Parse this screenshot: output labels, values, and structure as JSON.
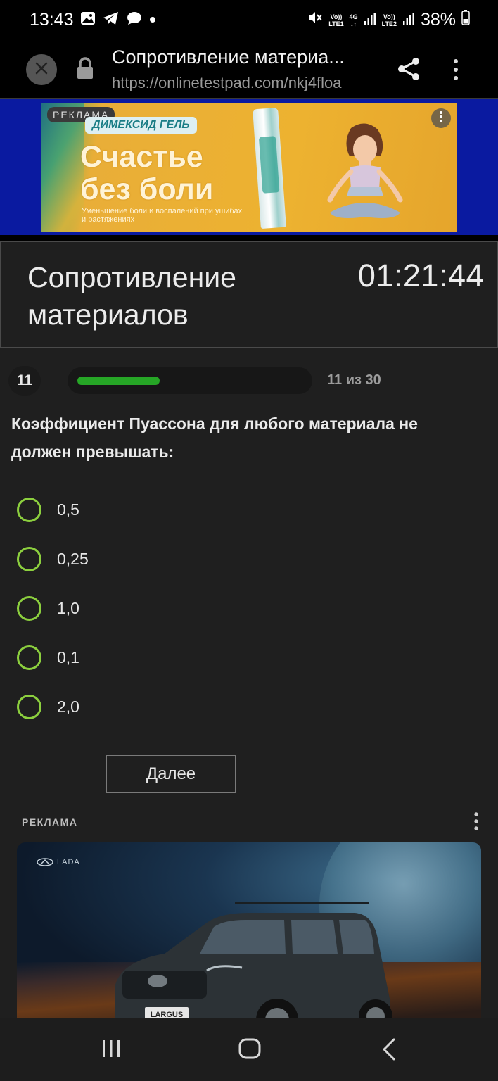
{
  "status_bar": {
    "time": "13:43",
    "battery": "38%",
    "sim1": {
      "line1": "Vo))",
      "line2": "LTE1"
    },
    "network": {
      "line1": "4G",
      "line2": "↓↑"
    },
    "sim2": {
      "line1": "Vo))",
      "line2": "LTE2"
    },
    "icons": [
      "image-icon",
      "telegram-icon",
      "chat-icon",
      "dot-icon",
      "mute-icon",
      "signal-icon",
      "battery-icon"
    ]
  },
  "browser": {
    "title": "Сопротивление материа...",
    "url": "https://onlinetestpad.com/nkj4floa"
  },
  "top_ad": {
    "label": "РЕКЛАМА",
    "brand": "ДИМЕКСИД ГЕЛЬ",
    "slogan_line1": "Счастье",
    "slogan_line2": "без боли",
    "subtitle": "Уменьшение боли и воспалений при ушибах и растяжениях"
  },
  "test": {
    "title": "Сопротивление материалов",
    "timer": "01:21:44",
    "question_number": "11",
    "progress_text": "11 из 30",
    "progress": {
      "current": 11,
      "total": 30
    },
    "question": "Коэффициент Пуассона для любого материала не должен превышать:",
    "options": [
      "0,5",
      "0,25",
      "1,0",
      "0,1",
      "2,0"
    ],
    "next_label": "Далее"
  },
  "bottom_ad": {
    "label": "РЕКЛАМА",
    "logo": "LADA",
    "plate": "LARGUS"
  },
  "colors": {
    "accent_green": "#26a626",
    "radio_green": "#8ccf3e",
    "background": "#1f1f1f"
  }
}
